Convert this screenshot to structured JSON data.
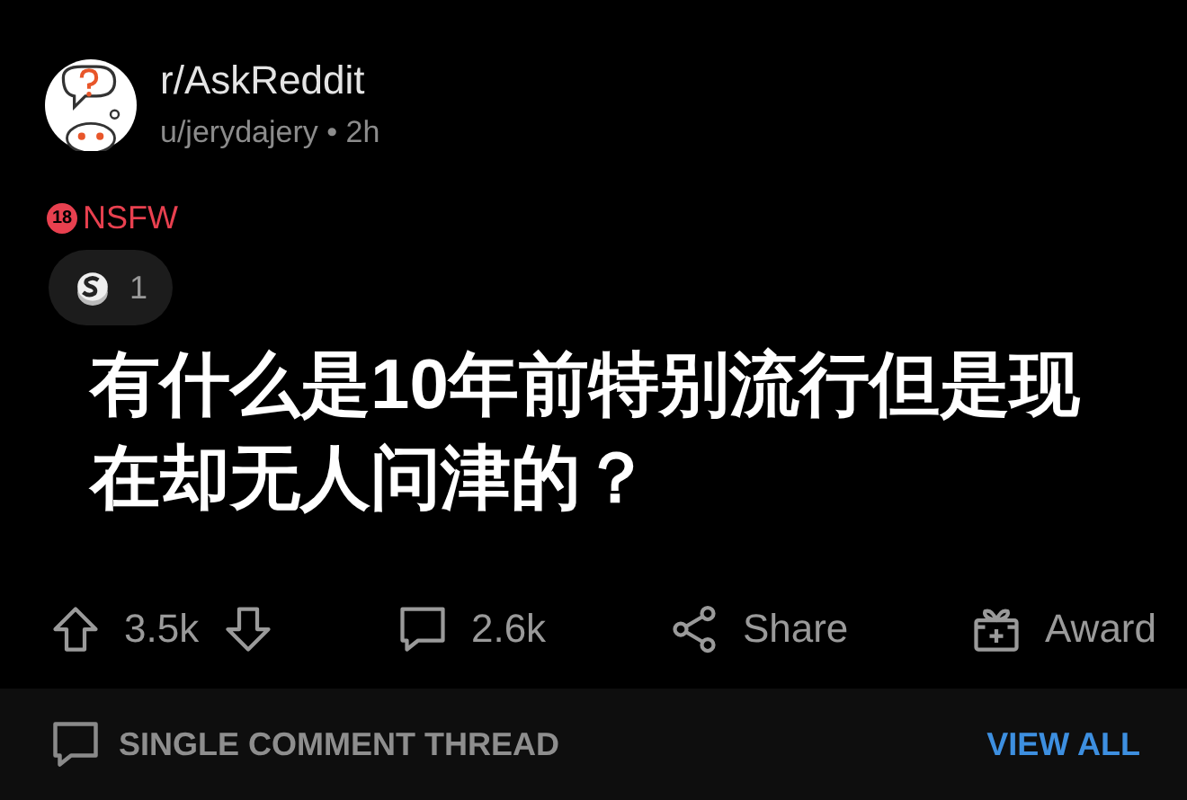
{
  "post": {
    "subreddit": "r/AskReddit",
    "byline": "u/jerydajery • 2h",
    "nsfw": {
      "badge": "18",
      "label": "NSFW"
    },
    "awards": [
      {
        "count": "1"
      }
    ],
    "title": "有什么是10年前特别流行但是现在却无人问津的？"
  },
  "actions": [
    {
      "kind": "vote",
      "label": "3.5k"
    },
    {
      "kind": "comment",
      "label": "2.6k"
    },
    {
      "kind": "share",
      "label": "Share"
    },
    {
      "kind": "award",
      "label": "Award"
    }
  ],
  "thread_bar": {
    "label": "SINGLE COMMENT THREAD",
    "link": "VIEW ALL"
  }
}
